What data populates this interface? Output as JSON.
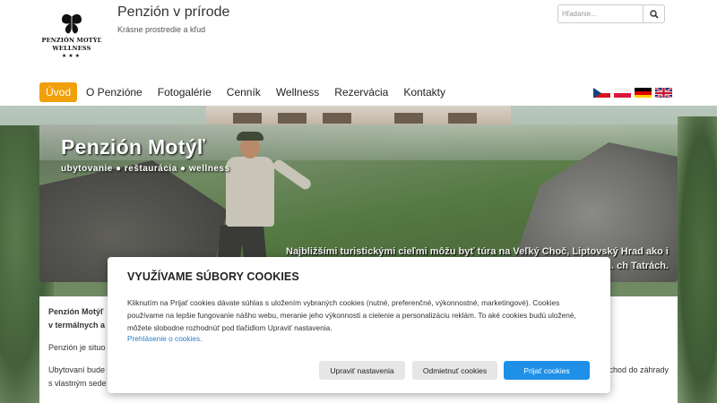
{
  "header": {
    "title": "Penzión v prírode",
    "subtitle": "Krásne prostredie a kľud",
    "logo": {
      "name": "PENZIÓN MOTÝĽ",
      "sub": "WELLNESS",
      "stars": "★★★"
    },
    "search": {
      "placeholder": "Hľadanie...",
      "icon": "search-icon"
    }
  },
  "nav": {
    "items": [
      {
        "label": "Úvod",
        "active": true
      },
      {
        "label": "O Penzióne",
        "active": false
      },
      {
        "label": "Fotogalérie",
        "active": false
      },
      {
        "label": "Cenník",
        "active": false
      },
      {
        "label": "Wellness",
        "active": false
      },
      {
        "label": "Rezervácia",
        "active": false
      },
      {
        "label": "Kontakty",
        "active": false
      }
    ],
    "active_color": "#f0a00a",
    "languages": [
      "cs",
      "pl",
      "de",
      "en"
    ]
  },
  "banner": {
    "title": "Penzión Motýľ",
    "tagline": "ubytovanie ● reštaurácia ● wellness",
    "caption": "Najbližšími turistickými cieľmi môžu byť túra na Veľký Choč, Liptovský Hrad ako i Prosiecka ... ch Tatrách."
  },
  "content": {
    "intro_bold_1": "Penzión Motýľ",
    "intro_bold_2": "v termálnych a",
    "para_2": "Penzión je situo",
    "para_3_start": "Ubytovaní bude",
    "para_3_end": "chod do záhrady",
    "para_3_line2": "s vlastným sede"
  },
  "cookies": {
    "title": "VYUŽÍVAME SÚBORY COOKIES",
    "text": "Kliknutím na Prijať cookies dávate súhlas s uložením vybraných cookies (nutné, preferenčné, výkonnostné, marketingové). Cookies používame na lepšie fungovanie nášho webu, meranie jeho výkonnosti a cielenie a personalizáciu reklám. To aké cookies budú uložené, môžete slobodne rozhodnúť pod tlačidlom Upraviť nastavenia.",
    "link": "Prehlásenie o cookies.",
    "btn_settings": "Upraviť nastavenia",
    "btn_reject": "Odmietnuť cookies",
    "btn_accept": "Prijať cookies",
    "accept_color": "#1e90e8"
  }
}
